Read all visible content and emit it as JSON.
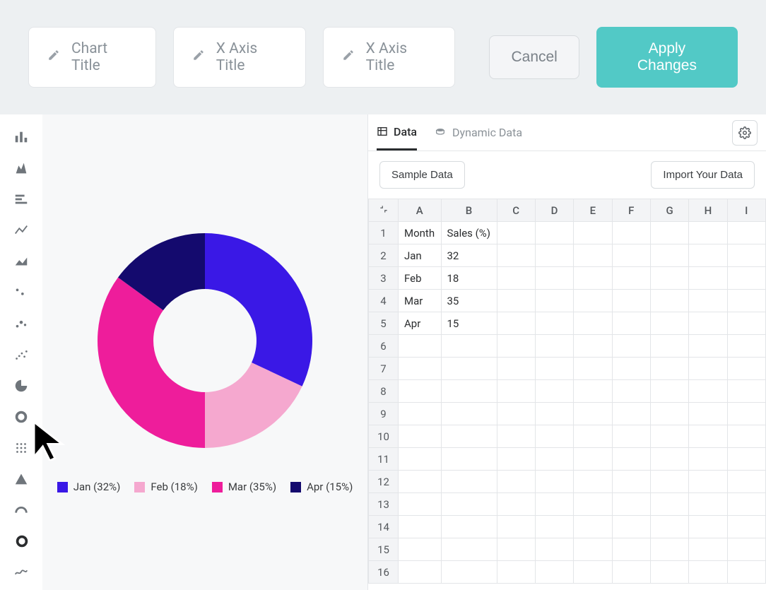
{
  "toolbar": {
    "chart_title_placeholder": "Chart Title",
    "x_axis_placeholder_1": "X Axis Title",
    "x_axis_placeholder_2": "X Axis Title",
    "cancel": "Cancel",
    "apply": "Apply Changes"
  },
  "rail_icons": [
    "bar-chart-icon",
    "column-chart-icon",
    "horizontal-bar-icon",
    "line-chart-icon",
    "area-chart-icon",
    "scatter-icon",
    "bubble-icon",
    "dot-plot-icon",
    "pie-icon",
    "donut-icon",
    "grid-icon",
    "pyramid-icon",
    "gauge-icon",
    "ring-icon",
    "sparkline-icon"
  ],
  "tabs": {
    "data": "Data",
    "dynamic_data": "Dynamic Data"
  },
  "data_actions": {
    "sample": "Sample Data",
    "import": "Import Your Data"
  },
  "sheet": {
    "columns": [
      "A",
      "B",
      "C",
      "D",
      "E",
      "F",
      "G",
      "H",
      "I"
    ],
    "rows": [
      {
        "n": "1",
        "cells": [
          "Month",
          "Sales (%)",
          "",
          "",
          "",
          "",
          "",
          "",
          ""
        ]
      },
      {
        "n": "2",
        "cells": [
          "Jan",
          "32",
          "",
          "",
          "",
          "",
          "",
          "",
          ""
        ]
      },
      {
        "n": "3",
        "cells": [
          "Feb",
          "18",
          "",
          "",
          "",
          "",
          "",
          "",
          ""
        ]
      },
      {
        "n": "4",
        "cells": [
          "Mar",
          "35",
          "",
          "",
          "",
          "",
          "",
          "",
          ""
        ]
      },
      {
        "n": "5",
        "cells": [
          "Apr",
          "15",
          "",
          "",
          "",
          "",
          "",
          "",
          ""
        ]
      },
      {
        "n": "6",
        "cells": [
          "",
          "",
          "",
          "",
          "",
          "",
          "",
          "",
          ""
        ]
      },
      {
        "n": "7",
        "cells": [
          "",
          "",
          "",
          "",
          "",
          "",
          "",
          "",
          ""
        ]
      },
      {
        "n": "8",
        "cells": [
          "",
          "",
          "",
          "",
          "",
          "",
          "",
          "",
          ""
        ]
      },
      {
        "n": "9",
        "cells": [
          "",
          "",
          "",
          "",
          "",
          "",
          "",
          "",
          ""
        ]
      },
      {
        "n": "10",
        "cells": [
          "",
          "",
          "",
          "",
          "",
          "",
          "",
          "",
          ""
        ]
      },
      {
        "n": "11",
        "cells": [
          "",
          "",
          "",
          "",
          "",
          "",
          "",
          "",
          ""
        ]
      },
      {
        "n": "12",
        "cells": [
          "",
          "",
          "",
          "",
          "",
          "",
          "",
          "",
          ""
        ]
      },
      {
        "n": "13",
        "cells": [
          "",
          "",
          "",
          "",
          "",
          "",
          "",
          "",
          ""
        ]
      },
      {
        "n": "14",
        "cells": [
          "",
          "",
          "",
          "",
          "",
          "",
          "",
          "",
          ""
        ]
      },
      {
        "n": "15",
        "cells": [
          "",
          "",
          "",
          "",
          "",
          "",
          "",
          "",
          ""
        ]
      },
      {
        "n": "16",
        "cells": [
          "",
          "",
          "",
          "",
          "",
          "",
          "",
          "",
          ""
        ]
      }
    ]
  },
  "legend": [
    {
      "label": "Jan (32%)",
      "color": "#3a18e6"
    },
    {
      "label": "Feb (18%)",
      "color": "#f5a8cf"
    },
    {
      "label": "Mar (35%)",
      "color": "#ee1d9b"
    },
    {
      "label": "Apr (15%)",
      "color": "#140a6e"
    }
  ],
  "chart_data": {
    "type": "pie",
    "subtype": "donut",
    "title": "",
    "series_label": "Sales (%)",
    "categories": [
      "Jan",
      "Feb",
      "Mar",
      "Apr"
    ],
    "values": [
      32,
      18,
      35,
      15
    ],
    "colors": [
      "#3a18e6",
      "#f5a8cf",
      "#ee1d9b",
      "#140a6e"
    ],
    "inner_radius_ratio": 0.48
  }
}
